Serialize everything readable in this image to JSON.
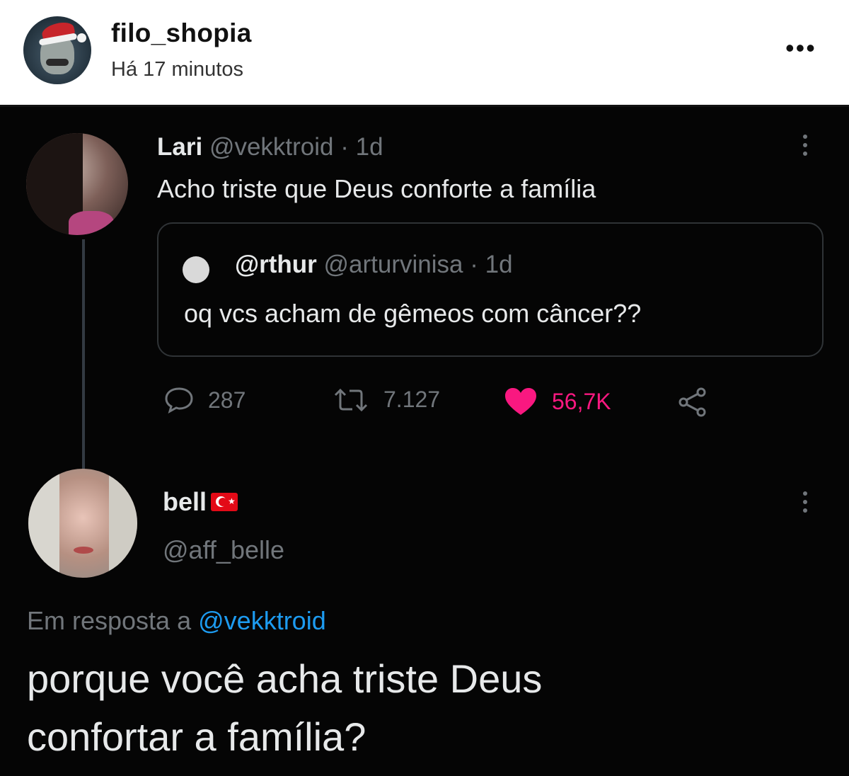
{
  "post": {
    "username": "filo_shopia",
    "time": "Há 17 minutos",
    "more_icon": "ellipsis-horizontal-icon"
  },
  "tweet": {
    "name": "Lari",
    "handle": "@vekktroid",
    "age": "· 1d",
    "text": "Acho triste que Deus conforte a família",
    "quoted": {
      "name": "@rthur",
      "handle": "@arturvinisa",
      "age": "· 1d",
      "text": "oq vcs acham de gêmeos com câncer??"
    },
    "actions": {
      "replies": "287",
      "retweets": "7.127",
      "likes": "56,7K"
    }
  },
  "reply": {
    "name": "bell",
    "handle": "@aff_belle",
    "replying_label": "Em resposta a",
    "replying_to": "@vekktroid",
    "text_line1": "porque você acha triste Deus",
    "text_line2": "confortar a família?"
  },
  "colors": {
    "background": "#050505",
    "text": "#e7e9ea",
    "muted": "#71767b",
    "like": "#f91880",
    "link": "#1d9bf0"
  }
}
